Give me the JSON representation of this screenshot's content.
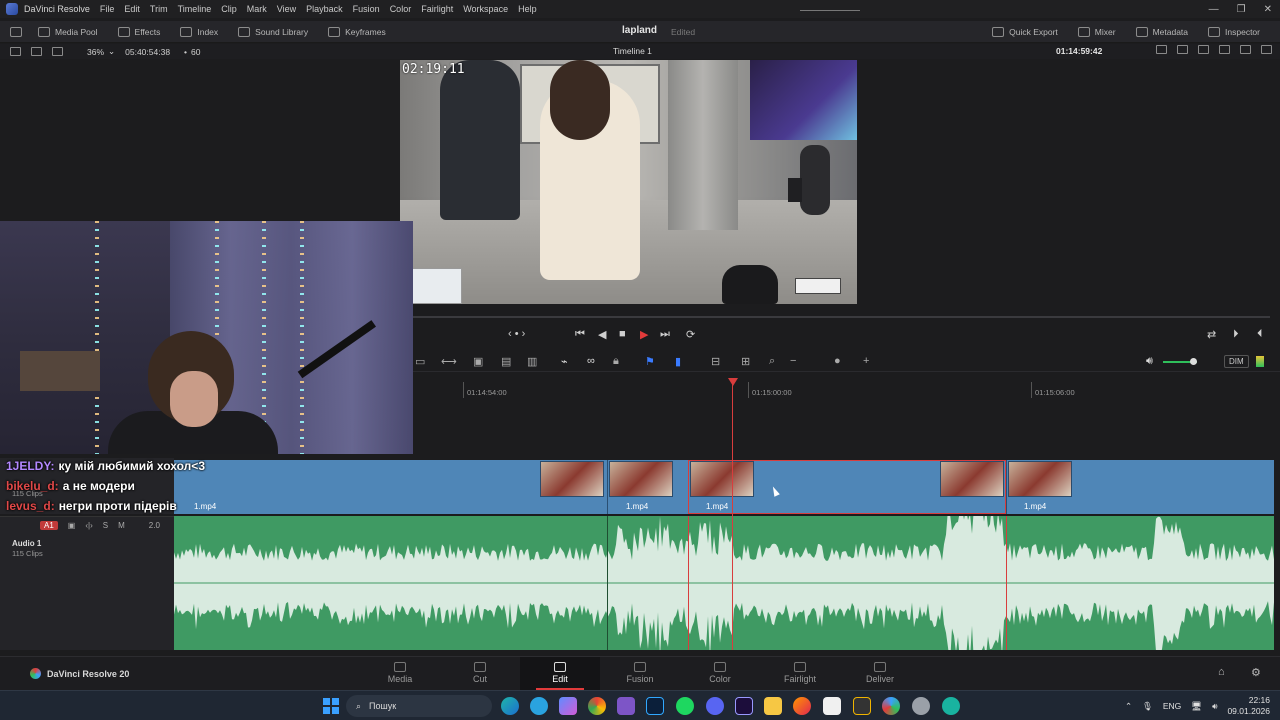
{
  "app": {
    "name": "DaVinci Resolve",
    "menu": [
      "File",
      "Edit",
      "Trim",
      "Timeline",
      "Clip",
      "Mark",
      "View",
      "Playback",
      "Fusion",
      "Color",
      "Fairlight",
      "Workspace",
      "Help"
    ]
  },
  "toolbar": {
    "left": [
      "Media Pool",
      "Effects",
      "Index",
      "Sound Library",
      "Keyframes"
    ],
    "project_title": "lapland",
    "project_status": "Edited",
    "right": [
      "Quick Export",
      "Mixer",
      "Metadata",
      "Inspector"
    ]
  },
  "viewer_bar": {
    "zoom": "36%",
    "source_timecode": "05:40:54:38",
    "fps": "60",
    "timeline_name": "Timeline 1",
    "record_timecode": "01:14:59:42"
  },
  "viewer": {
    "overlay_time": "02:19:11"
  },
  "ruler": {
    "timecodes": [
      "01:14:54:00",
      "01:15:00:00",
      "01:15:06:00"
    ]
  },
  "tracks": {
    "video": {
      "count": "115 Clips",
      "clip_labels": [
        "1.mp4",
        "1.mp4",
        "1.mp4",
        "1.mp4"
      ]
    },
    "audio": {
      "tag": "A1",
      "solo": "S",
      "mute": "M",
      "level": "2.0",
      "name": "Audio 1",
      "count": "115 Clips"
    }
  },
  "timeline_toolbar": {
    "dim_label": "DIM"
  },
  "chat": [
    {
      "user": "1JELDY:",
      "message": "ку мій любимий хохол<3",
      "color": "#b388ff"
    },
    {
      "user": "bikelu_d:",
      "message": "а не модери",
      "color": "#e04848"
    },
    {
      "user": "levus_d:",
      "message": "негри проти підерів",
      "color": "#e04848"
    }
  ],
  "pages": {
    "brand": "DaVinci Resolve 20",
    "tabs": [
      "Media",
      "Cut",
      "Edit",
      "Fusion",
      "Color",
      "Fairlight",
      "Deliver"
    ],
    "active": "Edit"
  },
  "taskbar": {
    "search_placeholder": "Пошук",
    "language": "ENG",
    "time": "22:16",
    "date": "09.01.2026"
  },
  "colors": {
    "accent_red": "#e23b3b",
    "video_track": "#4f86b7",
    "audio_track": "#3f9a63"
  }
}
